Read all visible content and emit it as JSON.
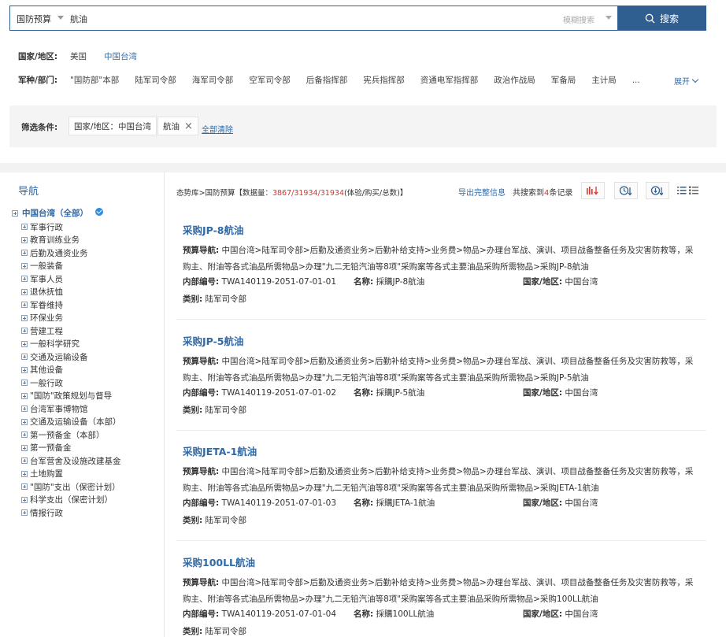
{
  "search": {
    "scope": "国防预算",
    "value": "航油",
    "mode": "模糊搜索",
    "button": "搜索"
  },
  "filters": {
    "country": {
      "label": "国家/地区:",
      "options": [
        "美国",
        "中国台湾"
      ]
    },
    "dept": {
      "label": "军种/部门:",
      "options": [
        "\"国防部\"本部",
        "陆军司令部",
        "海军司令部",
        "空军司令部",
        "后备指挥部",
        "宪兵指挥部",
        "资通电军指挥部",
        "政治作战局",
        "军备局",
        "主计局",
        "..."
      ],
      "expand": "展开"
    }
  },
  "conditions": {
    "label": "筛选条件:",
    "chip1": "国家/地区：中国台湾",
    "chip2": "航油",
    "clear": "全部清除"
  },
  "sidebar": {
    "title": "导航",
    "root": "中国台湾（全部）",
    "items": [
      "军事行政",
      "教育训练业务",
      "后勤及通资业务",
      "一般装备",
      "军事人员",
      "退休抚恤",
      "军眷维持",
      "环保业务",
      "营建工程",
      "一般科学研究",
      "交通及运输设备",
      "其他设备",
      "一般行政",
      "\"国防\"政策规划与督导",
      "台湾军事博物馆",
      "交通及运输设备（本部）",
      "第一预备金（本部）",
      "第一预备金",
      "台军营舍及设施改建基金",
      "土地购置",
      "\"国防\"支出（保密计划）",
      "科学支出（保密计划）",
      "情报行政"
    ]
  },
  "toolbar": {
    "crumb_prefix": "态势库>国防预算【数据量：",
    "crumb_count": "3867/31934/31934",
    "crumb_suffix": "(体验/购买/总数)】",
    "export": "导出完整信息",
    "total_prefix": "共搜索到",
    "total_count": "4",
    "total_suffix": "条记录"
  },
  "labels": {
    "nav": "预算导航:",
    "code": "内部编号:",
    "name": "名称:",
    "country": "国家/地区:",
    "category": "类别:"
  },
  "records": [
    {
      "title": "采购JP-8航油",
      "nav": "中国台湾>陆军司令部>后勤及通资业务>后勤补给支持>业务费>物品>办理台军战、演训、项目战备整备任务及灾害防救等，采购主、附油等各式油品所需物品>办理\"九二无铅汽油等8项\"采购案等各式主要油品采购所需物品>采购JP-8航油",
      "code": "TWA140119-2051-07-01-01",
      "name": "採購JP-8航油",
      "country": "中国台湾",
      "category": "陆军司令部"
    },
    {
      "title": "采购JP-5航油",
      "nav": "中国台湾>陆军司令部>后勤及通资业务>后勤补给支持>业务费>物品>办理台军战、演训、项目战备整备任务及灾害防救等，采购主、附油等各式油品所需物品>办理\"九二无铅汽油等8项\"采购案等各式主要油品采购所需物品>采购JP-5航油",
      "code": "TWA140119-2051-07-01-02",
      "name": "採購JP-5航油",
      "country": "中国台湾",
      "category": "陆军司令部"
    },
    {
      "title": "采购JETA-1航油",
      "nav": "中国台湾>陆军司令部>后勤及通资业务>后勤补给支持>业务费>物品>办理台军战、演训、项目战备整备任务及灾害防救等，采购主、附油等各式油品所需物品>办理\"九二无铅汽油等8项\"采购案等各式主要油品采购所需物品>采购JETA-1航油",
      "code": "TWA140119-2051-07-01-03",
      "name": "採購JETA-1航油",
      "country": "中国台湾",
      "category": "陆军司令部"
    },
    {
      "title": "采购100LL航油",
      "nav": "中国台湾>陆军司令部>后勤及通资业务>后勤补给支持>业务费>物品>办理台军战、演训、项目战备整备任务及灾害防救等，采购主、附油等各式油品所需物品>办理\"九二无铅汽油等8项\"采购案等各式主要油品采购所需物品>采购100LL航油",
      "code": "TWA140119-2051-07-01-04",
      "name": "採購100LL航油",
      "country": "中国台湾",
      "category": "陆军司令部"
    }
  ],
  "colors": {
    "primary": "#2f5e91",
    "link": "#2f6aa8",
    "highlight": "#d9342b"
  }
}
